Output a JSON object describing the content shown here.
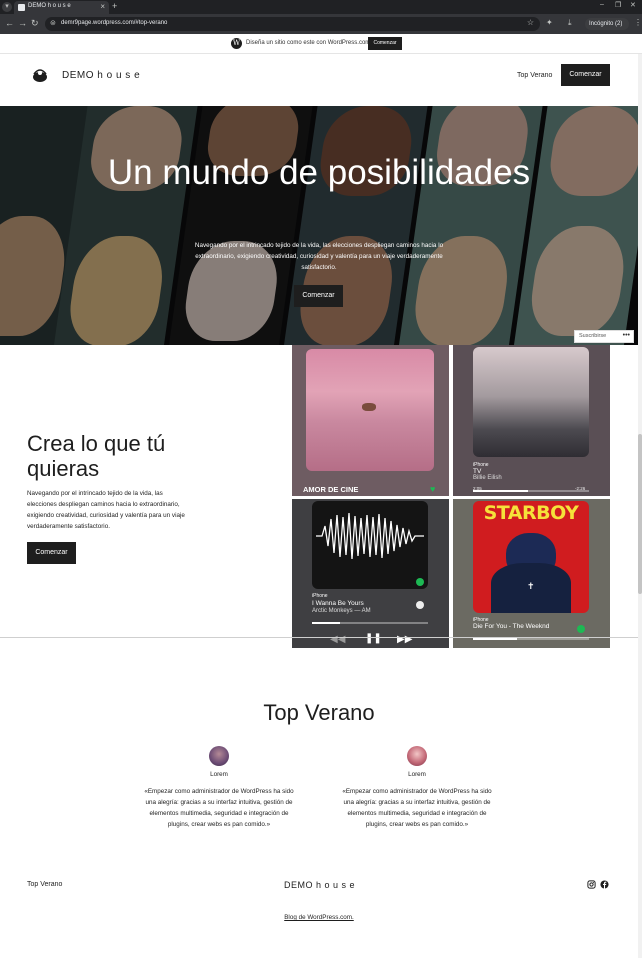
{
  "browser": {
    "tab_title": "DEMO h o u s e",
    "url": "demr9page.wordpress.com/#top-verano",
    "incognito_label": "Incógnito (2)"
  },
  "wp_banner": {
    "text": "Diseña un sitio como este con WordPress.com",
    "button": "Comenzar"
  },
  "header": {
    "site_title": "DEMO h o u s e",
    "nav_link": "Top Verano",
    "cta": "Comenzar"
  },
  "hero": {
    "title": "Un mundo de posibilidades",
    "subtitle": "Navegando por el intrincado tejido de la vida, las elecciones despliegan caminos hacia lo extraordinario, exigiendo creatividad, curiosidad y valentía para un viaje verdaderamente satisfactorio.",
    "button": "Comenzar"
  },
  "subscribe": {
    "label": "Suscribirse"
  },
  "feature": {
    "title": "Crea lo que tú quieras",
    "text": "Navegando por el intrincado tejido de la vida, las elecciones despliegan caminos hacia lo extraordinario, exigiendo creatividad, curiosidad y valentía para un viaje verdaderamente satisfactorio.",
    "button": "Comenzar"
  },
  "tiles": {
    "cloud": {
      "label": "AMOR DE CINE"
    },
    "tv": {
      "device": "iPhone",
      "title": "TV",
      "artist": "Billie Eilish",
      "elapsed": "2:05",
      "remaining": "-2:26"
    },
    "am": {
      "device": "iPhone",
      "title": "I Wanna Be Yours",
      "artist": "Arctic Monkeys — AM"
    },
    "starboy": {
      "cover_text": "STARBOY",
      "device": "iPhone",
      "title": "Die For You - The Weeknd"
    }
  },
  "top_verano": {
    "title": "Top Verano",
    "testimonials": [
      {
        "name": "Lorem",
        "quote": "«Empezar como administrador de WordPress ha sido una alegría: gracias a su interfaz intuitiva, gestión de elementos multimedia, seguridad e integración de plugins, crear webs es pan comido.»"
      },
      {
        "name": "Lorem",
        "quote": "«Empezar como administrador de WordPress ha sido una alegría: gracias a su interfaz intuitiva, gestión de elementos multimedia, seguridad e integración de plugins, crear webs es pan comido.»"
      }
    ]
  },
  "footer": {
    "left_link": "Top Verano",
    "site_title": "DEMO h o u s e",
    "credit": "Blog de WordPress.com."
  },
  "colors": {
    "button_dark": "#1e1e1e",
    "spotify_green": "#1db954",
    "starboy_red": "#d01c1f"
  },
  "icons": [
    "search-icon",
    "star-icon",
    "instagram-icon",
    "facebook-icon",
    "wordpress-icon"
  ]
}
